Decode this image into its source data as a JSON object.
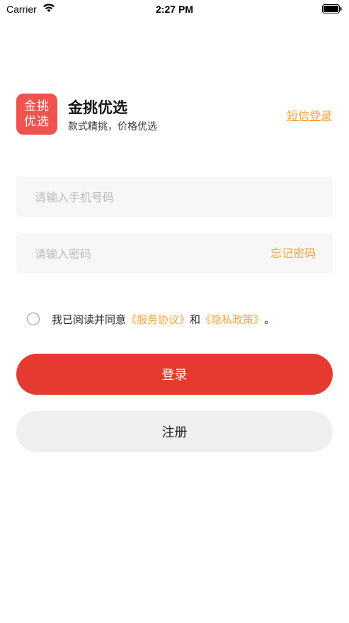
{
  "status_bar": {
    "carrier": "Carrier",
    "time": "2:27 PM"
  },
  "brand": {
    "logo_line1": "金挑",
    "logo_line2": "优选",
    "name": "金挑优选",
    "slogan": "款式精挑，价格优选",
    "logo_color": "#f0534d"
  },
  "header": {
    "sms_login_label": "短信登录"
  },
  "form": {
    "phone_placeholder": "请输入手机号码",
    "phone_value": "",
    "password_placeholder": "请输入密码",
    "password_value": "",
    "forgot_password_label": "忘记密码"
  },
  "agreement": {
    "checked": false,
    "prefix": "我已阅读并同意",
    "service_agreement": "《服务协议》",
    "and": "和",
    "privacy_policy": "《隐私政策》",
    "suffix": "。"
  },
  "buttons": {
    "login_label": "登录",
    "register_label": "注册"
  },
  "colors": {
    "primary": "#e63a31",
    "accent": "#f4a43b",
    "field_bg": "#f7f7f7",
    "secondary_button_bg": "#efefef"
  }
}
